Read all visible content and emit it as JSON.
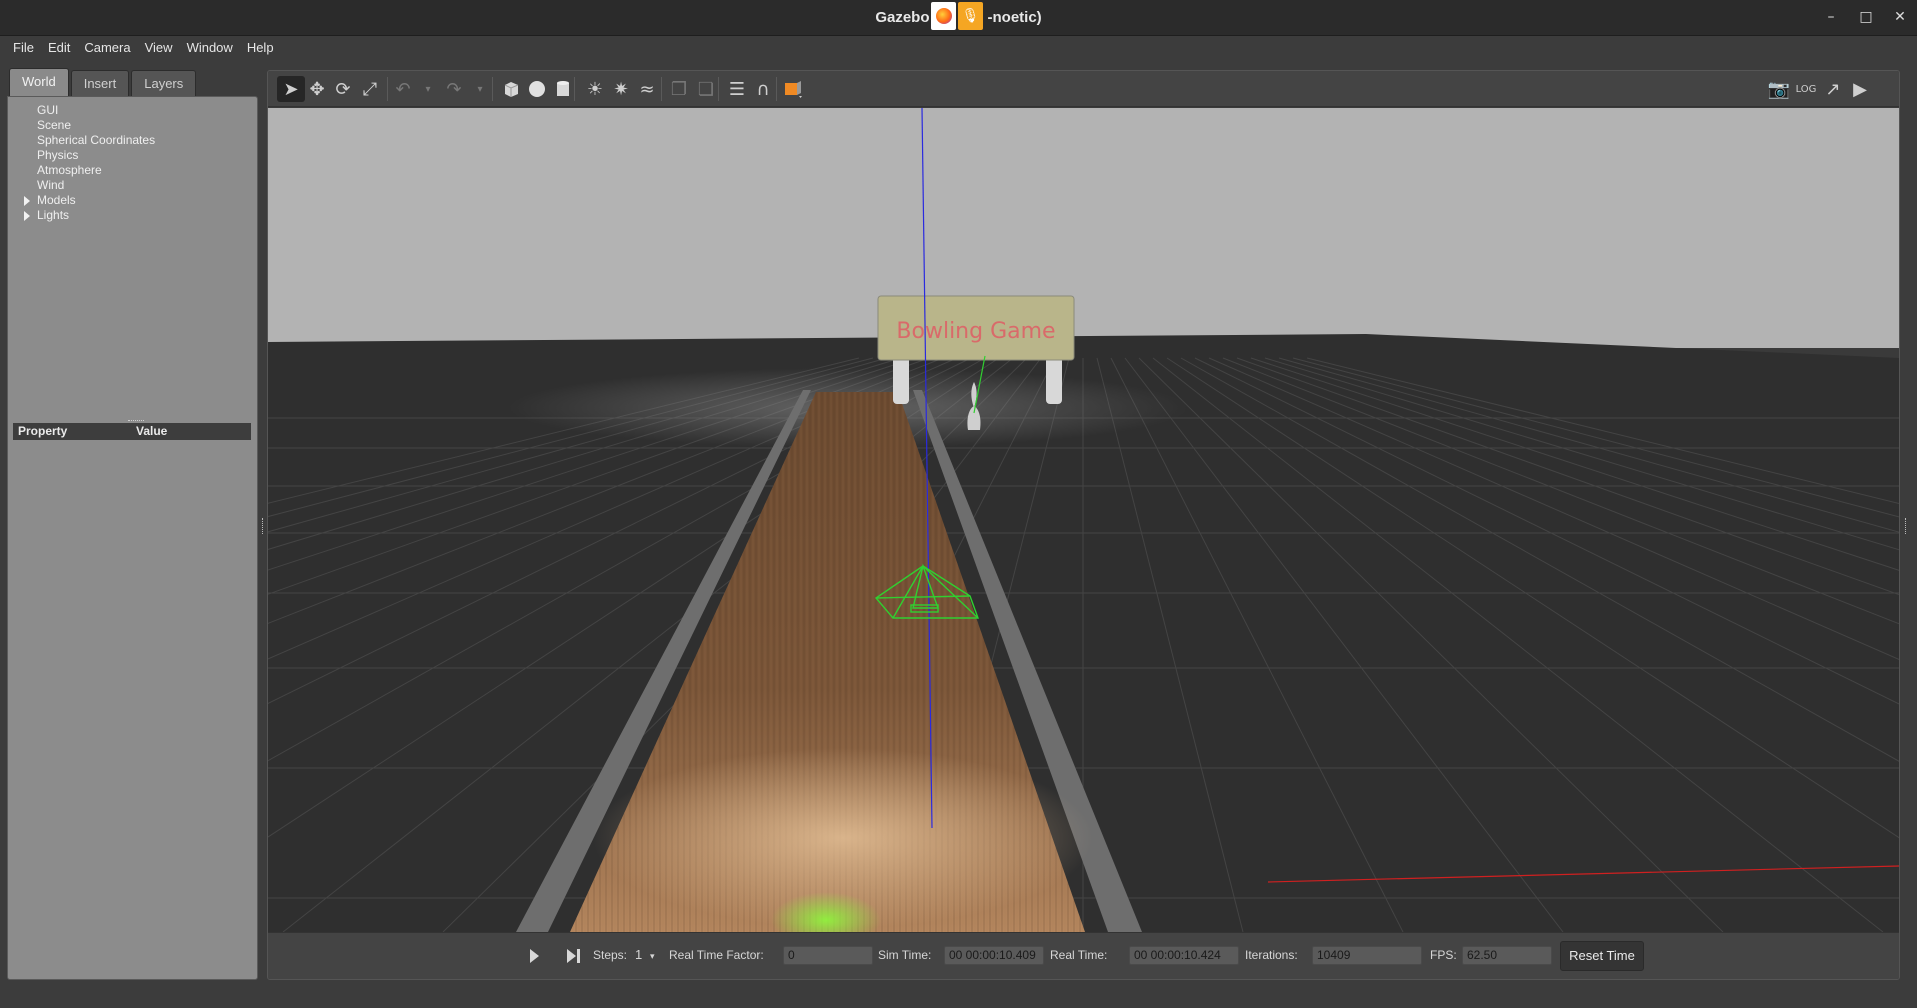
{
  "window": {
    "title": "Gazebo (ros-noetic)",
    "title_visible": "Gazebo",
    "title_suffix": "-noetic)",
    "controls": [
      "minimize-icon",
      "maximize-icon",
      "close-icon"
    ]
  },
  "menubar": {
    "items": [
      "File",
      "Edit",
      "Camera",
      "View",
      "Window",
      "Help"
    ]
  },
  "left_panel": {
    "tabs": [
      {
        "label": "World",
        "active": true
      },
      {
        "label": "Insert",
        "active": false
      },
      {
        "label": "Layers",
        "active": false
      }
    ],
    "tree": [
      {
        "label": "GUI",
        "expandable": false
      },
      {
        "label": "Scene",
        "expandable": false
      },
      {
        "label": "Spherical Coordinates",
        "expandable": false
      },
      {
        "label": "Physics",
        "expandable": false
      },
      {
        "label": "Atmosphere",
        "expandable": false
      },
      {
        "label": "Wind",
        "expandable": false
      },
      {
        "label": "Models",
        "expandable": true
      },
      {
        "label": "Lights",
        "expandable": true
      }
    ],
    "property_header": {
      "property": "Property",
      "value": "Value"
    }
  },
  "toolbar": {
    "icons": [
      "select-arrow-icon",
      "translate-icon",
      "rotate-icon",
      "scale-icon",
      "undo-icon",
      "redo-icon",
      "box-shape-icon",
      "sphere-shape-icon",
      "cylinder-shape-icon",
      "point-light-icon",
      "spot-light-icon",
      "directional-light-icon",
      "copy-icon",
      "paste-icon",
      "align-icon",
      "snap-magnet-icon",
      "view-angle-icon"
    ],
    "right_icons": [
      "screenshot-camera-icon",
      "log-icon",
      "plot-icon",
      "video-record-icon"
    ]
  },
  "scene": {
    "sign_text": "Bowling Game",
    "colors": {
      "sky": "#b3b3b3",
      "ground": "#2f2f2f",
      "lane": "#7a5538",
      "sign_bg": "#b9b58a",
      "sign_text": "#d96a6a",
      "frustum": "#30d030",
      "z_axis": "#2a2adf",
      "x_axis": "#d02020"
    }
  },
  "bottombar": {
    "steps_label": "Steps:",
    "steps_value": "1",
    "rtf_label": "Real Time Factor:",
    "rtf_value": "0",
    "sim_time_label": "Sim Time:",
    "sim_time_value": "00 00:00:10.409",
    "real_time_label": "Real Time:",
    "real_time_value": "00 00:00:10.424",
    "iterations_label": "Iterations:",
    "iterations_value": "10409",
    "fps_label": "FPS:",
    "fps_value": "62.50",
    "reset_label": "Reset Time"
  }
}
